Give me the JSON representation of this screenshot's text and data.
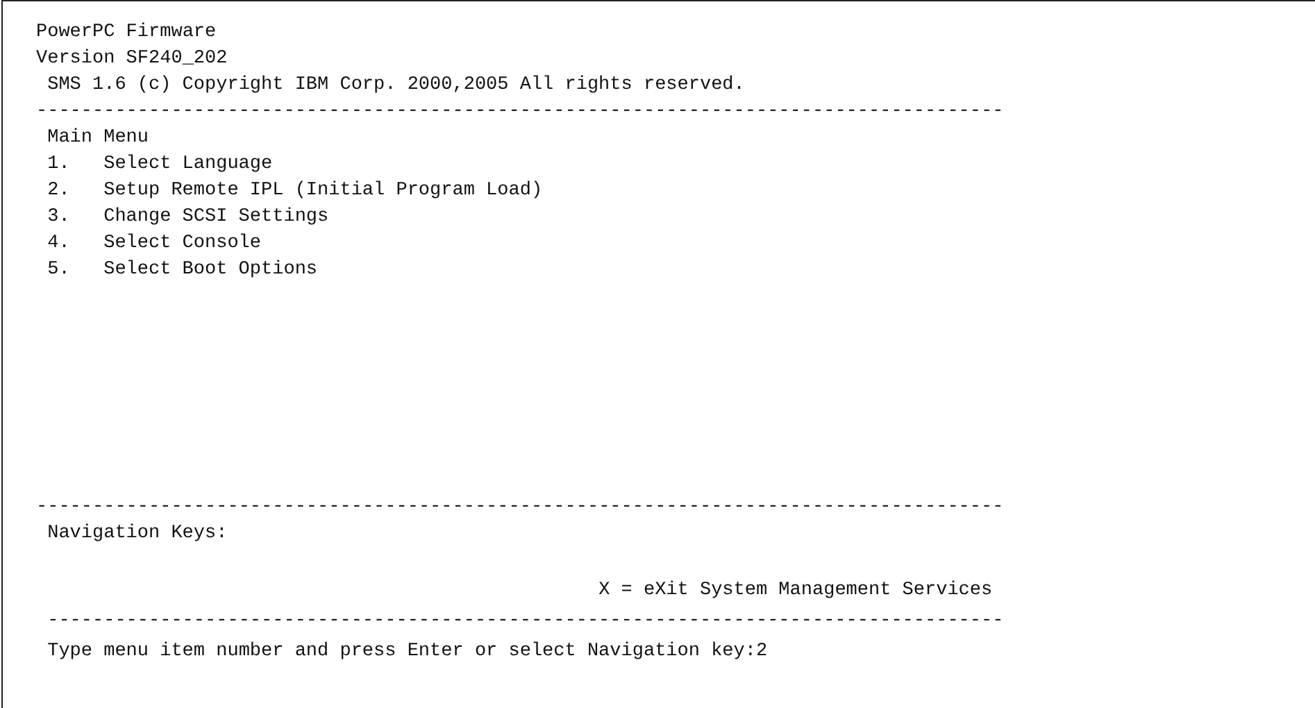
{
  "screen": {
    "lines": [
      {
        "kind": "text",
        "text": "PowerPC Firmware"
      },
      {
        "kind": "text",
        "text": "Version SF240_202"
      },
      {
        "kind": "indented",
        "text": "SMS 1.6 (c) Copyright IBM Corp. 2000,2005 All rights reserved."
      },
      {
        "kind": "rule",
        "text": "--------------------------------------------------------------------------------------"
      },
      {
        "kind": "indented",
        "text": "Main Menu"
      },
      {
        "kind": "item",
        "number": "1.",
        "label": "Select Language"
      },
      {
        "kind": "item",
        "number": "2.",
        "label": "Setup Remote IPL (Initial Program Load)"
      },
      {
        "kind": "item",
        "number": "3.",
        "label": "Change SCSI Settings"
      },
      {
        "kind": "item",
        "number": "4.",
        "label": "Select Console"
      },
      {
        "kind": "item",
        "number": "5.",
        "label": "Select Boot Options"
      },
      {
        "kind": "blank"
      },
      {
        "kind": "blank"
      },
      {
        "kind": "blank"
      },
      {
        "kind": "blank"
      },
      {
        "kind": "blank"
      },
      {
        "kind": "blank"
      },
      {
        "kind": "blank"
      },
      {
        "kind": "blank"
      },
      {
        "kind": "rule",
        "text": "--------------------------------------------------------------------------------------"
      },
      {
        "kind": "indented",
        "text": "Navigation Keys:"
      },
      {
        "kind": "blank"
      },
      {
        "kind": "key",
        "text": "X = eXit System Management Services"
      },
      {
        "kind": "indented-rule",
        "text": "-------------------------------------------------------------------------------------"
      },
      {
        "kind": "prompt",
        "text": "Type menu item number and press Enter or select Navigation key:",
        "value": "2"
      }
    ]
  }
}
